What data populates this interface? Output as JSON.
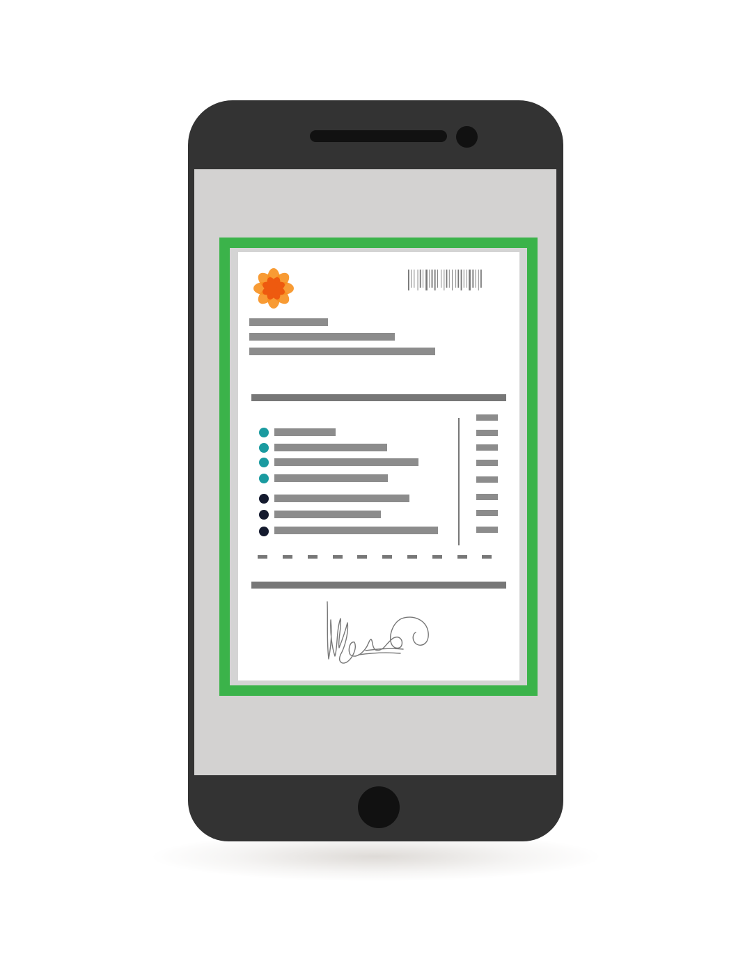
{
  "colors": {
    "phone_body": "#333333",
    "phone_button": "#111111",
    "screen": "#d3d2d1",
    "frame": "#3bb34a",
    "paper": "#ffffff",
    "text_bar": "#8c8c8c",
    "rule": "#777777",
    "dot_teal": "#1a9ba0",
    "dot_navy": "#141a2e",
    "logo_outer": "#f7901e",
    "logo_inner": "#ee5a0f",
    "signature_ink": "#777777"
  },
  "icons": {
    "logo": "orange-flower-logo",
    "barcode": "barcode",
    "signature": "handwritten-signature"
  },
  "document": {
    "item_count": 7,
    "teal_items": 4,
    "navy_items": 3
  }
}
